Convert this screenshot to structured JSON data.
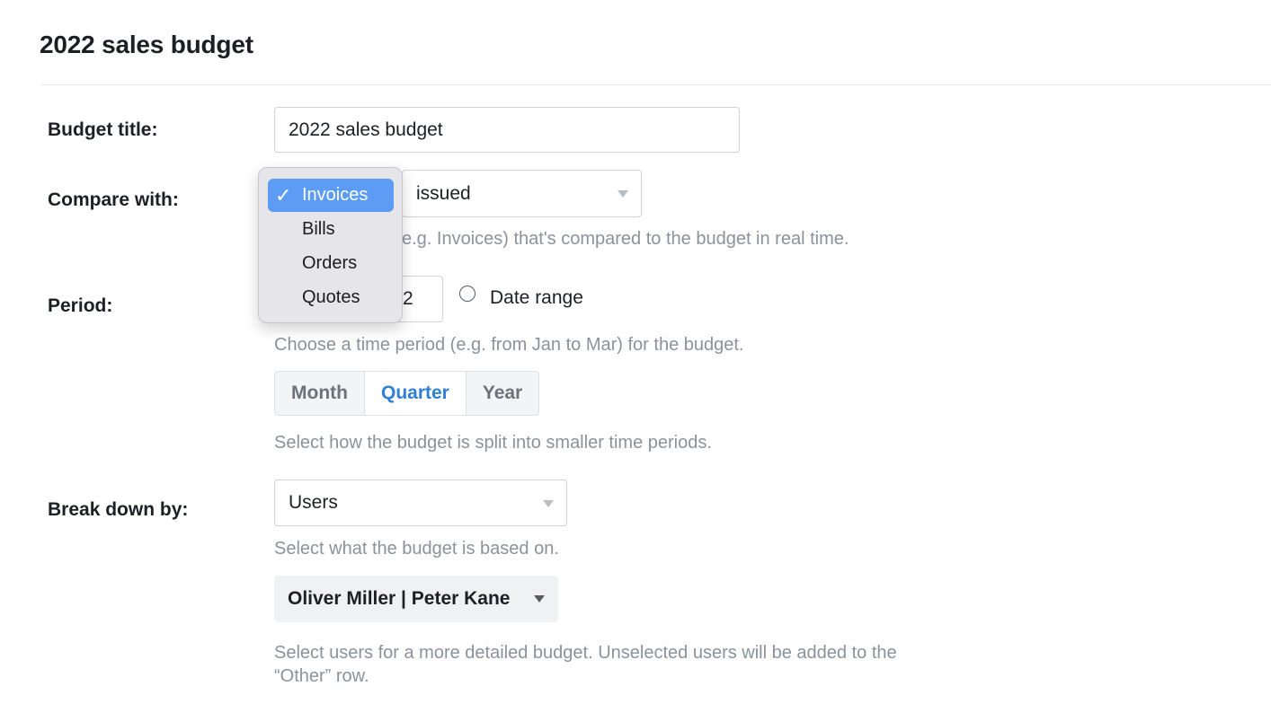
{
  "page": {
    "title": "2022 sales budget"
  },
  "labels": {
    "budget_title": "Budget title:",
    "compare_with": "Compare with:",
    "period": "Period:",
    "break_down_by": "Break down by:"
  },
  "budget_title_input": {
    "value": "2022 sales budget"
  },
  "compare": {
    "status_select": "issued",
    "help_visible": "e.g. Invoices) that's compared to the budget in real time.",
    "dropdown": {
      "check_icon": "✓",
      "options": [
        "Invoices",
        "Bills",
        "Orders",
        "Quotes"
      ],
      "selected": "Invoices"
    }
  },
  "period": {
    "year_fragment": "2",
    "date_range_label": "Date range",
    "help": "Choose a time period (e.g. from Jan to Mar) for the budget.",
    "split": {
      "options": [
        "Month",
        "Quarter",
        "Year"
      ],
      "active": "Quarter"
    },
    "split_help": "Select how the budget is split into smaller time periods."
  },
  "breakdown": {
    "select_value": "Users",
    "help": "Select what the budget is based on.",
    "users_value": "Oliver Miller | Peter Kane",
    "users_help": "Select users for a more detailed budget. Unselected users will be added to the “Other” row."
  },
  "colors": {
    "accent": "#2f7fd6",
    "menu_highlight": "#5c9cf5",
    "help_text": "#8b929b"
  }
}
